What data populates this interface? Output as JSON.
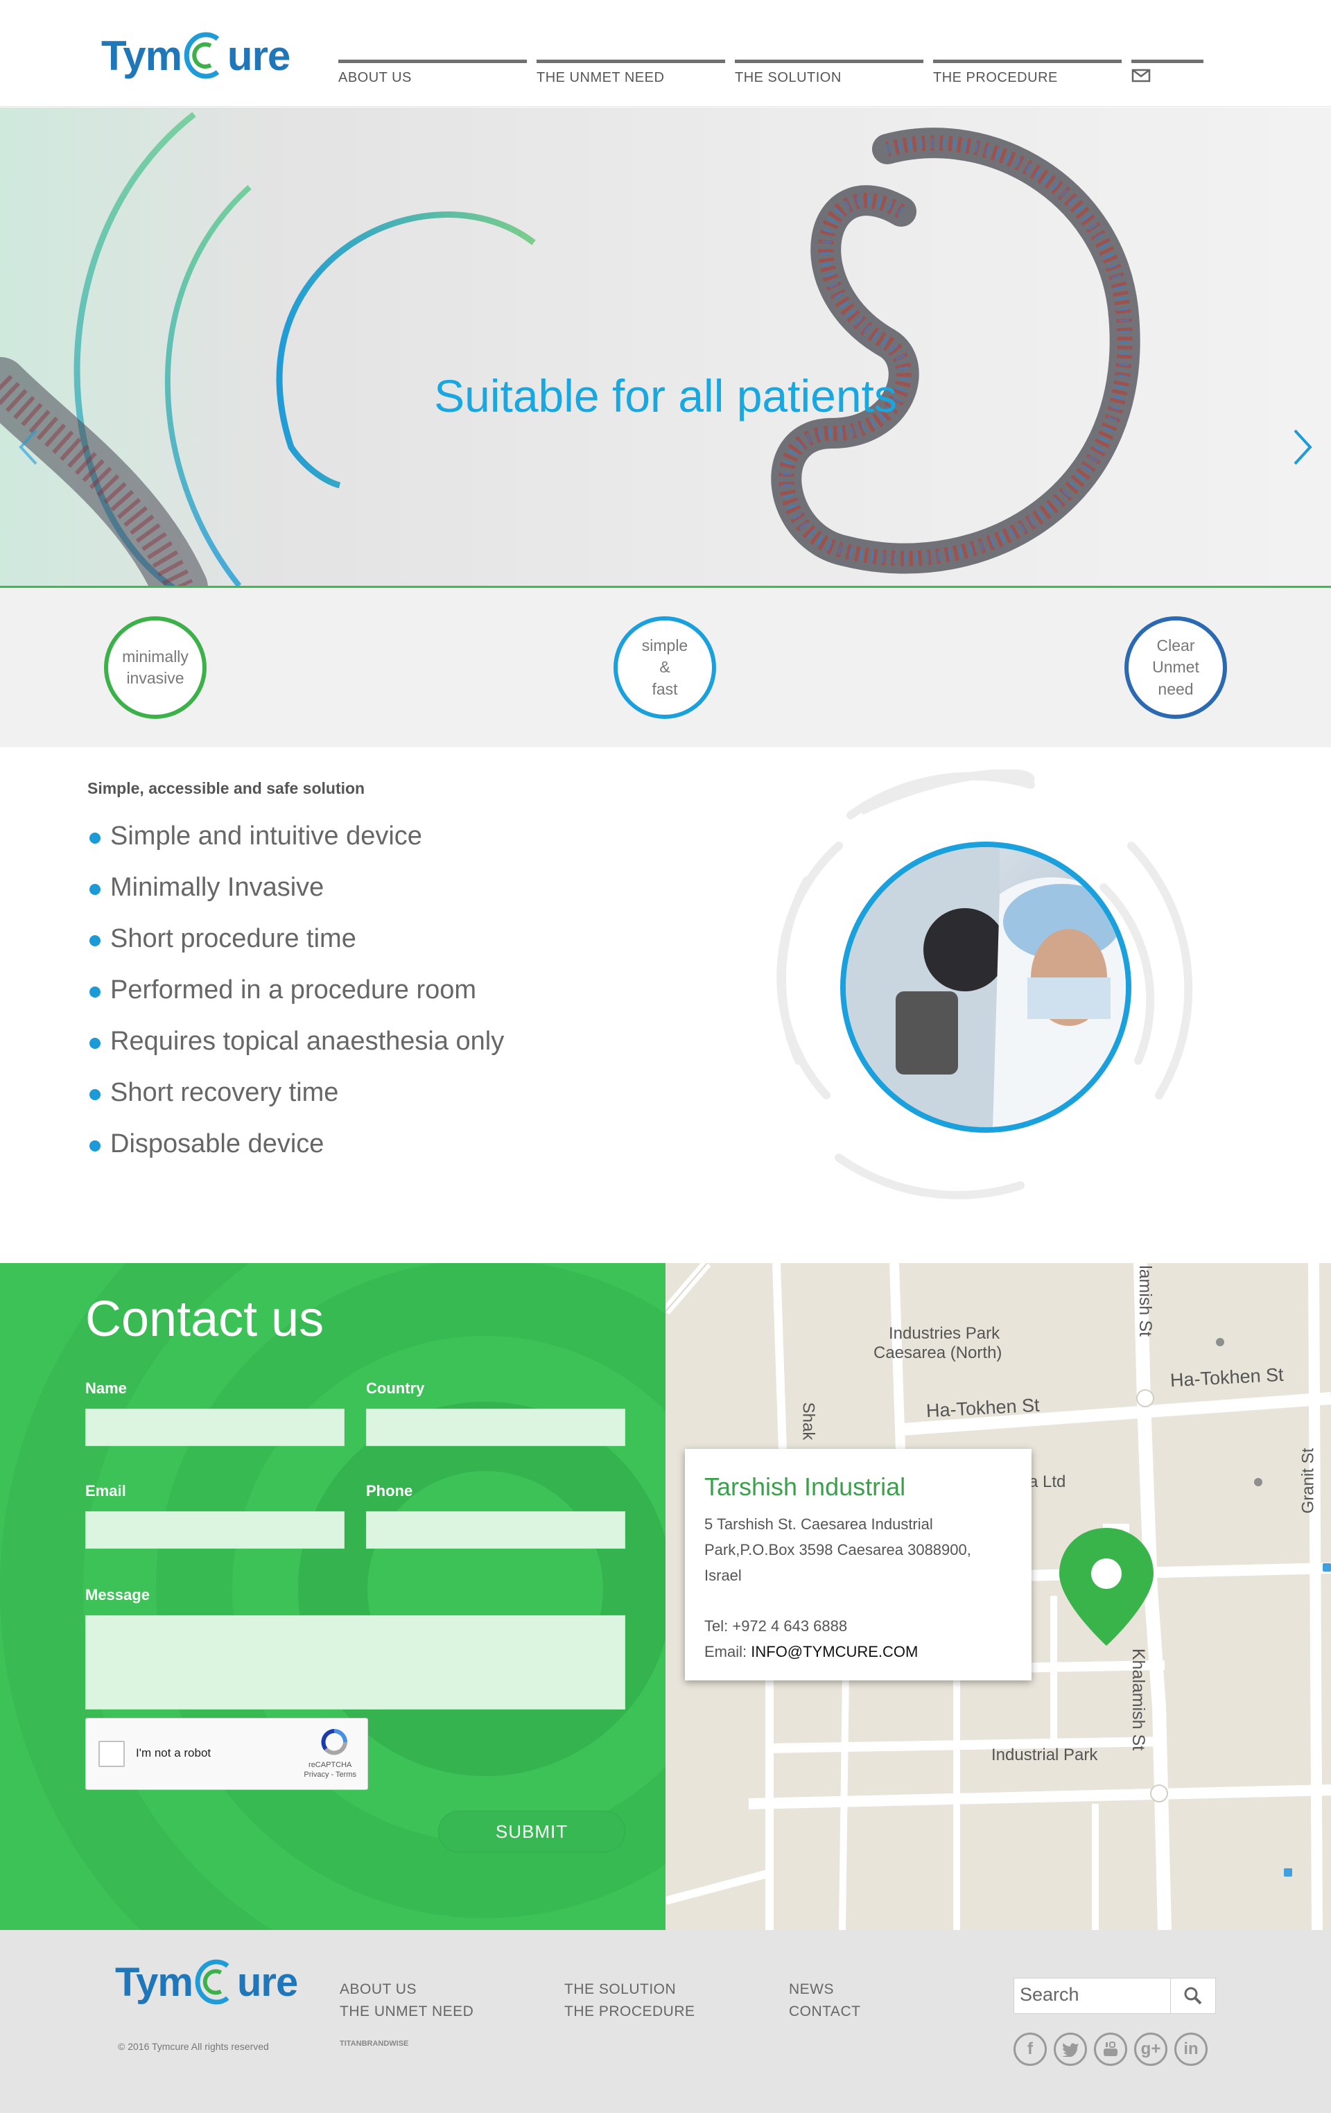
{
  "brand": {
    "logo_pre": "Tym",
    "logo_post": "ure"
  },
  "nav": {
    "items": [
      "ABOUT US",
      "THE UNMET NEED",
      "THE SOLUTION",
      "THE PROCEDURE"
    ],
    "mail_icon": "mail-icon"
  },
  "hero": {
    "title": "Suitable for all patients",
    "next_icon": "chevron-right-icon",
    "prev_icon": "chevron-left-icon"
  },
  "features": [
    {
      "label": "minimally\ninvasive",
      "color": "#3cb14a"
    },
    {
      "label": "simple\n&\nfast",
      "color": "#1aa0dd"
    },
    {
      "label": "Clear\nUnmet\nneed",
      "color": "#2b6ab2"
    }
  ],
  "solution": {
    "subtitle": "Simple, accessible and safe solution",
    "items": [
      "Simple and intuitive device",
      "Minimally Invasive",
      "Short procedure time",
      "Performed in a procedure room",
      "Requires topical anaesthesia only",
      "Short recovery time",
      "Disposable device"
    ]
  },
  "contact": {
    "title": "Contact us",
    "name_label": "Name",
    "country_label": "Country",
    "email_label": "Email",
    "phone_label": "Phone",
    "message_label": "Message",
    "recaptcha_label": "I'm not a robot",
    "recaptcha_brand": "reCAPTCHA",
    "recaptcha_terms": "Privacy - Terms",
    "submit_label": "SUBMIT"
  },
  "map": {
    "labels": {
      "industries_park_1": "Industries Park",
      "industries_park_2": "Caesarea (North)",
      "ha_tokhen_1": "Ha-Tokhen St",
      "ha_tokhen_2": "Ha-Tokhen St",
      "khalamish_top": "lamish St",
      "khalamish": "Khalamish St",
      "granit": "Granit St",
      "shak": "Shak",
      "ltd": "a Ltd",
      "industrial_park": "Industrial Park"
    },
    "card": {
      "title": "Tarshish Industrial",
      "address_1": "5 Tarshish St. Caesarea Industrial",
      "address_2": "Park,P.O.Box 3598 Caesarea 3088900,",
      "address_3": "Israel",
      "tel": "Tel: +972 4 643 6888",
      "email_label": "Email: ",
      "email": "INFO@TYMCURE.COM"
    }
  },
  "footer": {
    "col1": [
      "ABOUT US",
      "THE UNMET NEED"
    ],
    "col2": [
      "THE SOLUTION",
      "THE PROCEDURE"
    ],
    "col3": [
      "NEWS",
      "CONTACT"
    ],
    "copyright": "© 2016 Tymcure All rights reserved",
    "credit": "TITANBRANDWISE",
    "search_placeholder": "Search",
    "social": [
      "facebook-icon",
      "twitter-icon",
      "youtube-icon",
      "googleplus-icon",
      "linkedin-icon"
    ]
  },
  "colors": {
    "brand_blue": "#1f76b9",
    "accent_green": "#3dc258",
    "hero_text": "#18a7e0",
    "bullet": "#1c9ad8"
  }
}
